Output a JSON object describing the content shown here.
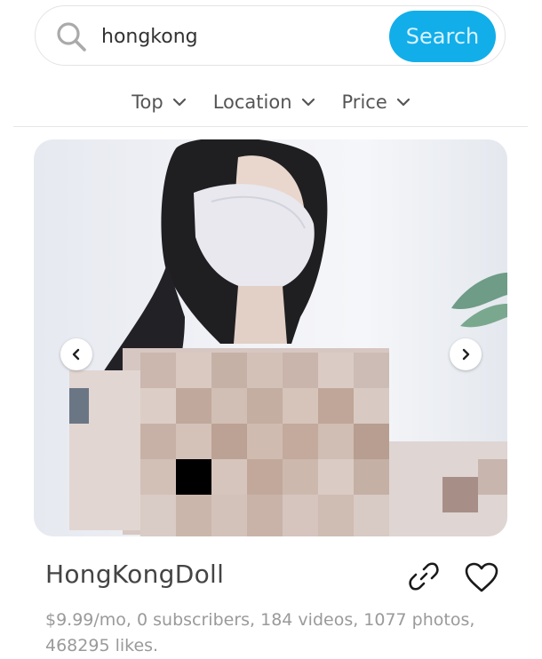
{
  "search": {
    "value": "hongkong",
    "button_label": "Search"
  },
  "filters": [
    {
      "label": "Top"
    },
    {
      "label": "Location"
    },
    {
      "label": "Price"
    }
  ],
  "profile": {
    "name": "HongKongDoll",
    "stats": "$9.99/mo, 0 subscribers, 184 videos, 1077 photos, 468295 likes."
  },
  "icons": {
    "search": "search-icon",
    "chevron": "chevron-down-icon",
    "prev": "chevron-left-icon",
    "next": "chevron-right-icon",
    "link": "link-icon",
    "favorite": "heart-icon"
  },
  "colors": {
    "accent": "#12aee9"
  }
}
